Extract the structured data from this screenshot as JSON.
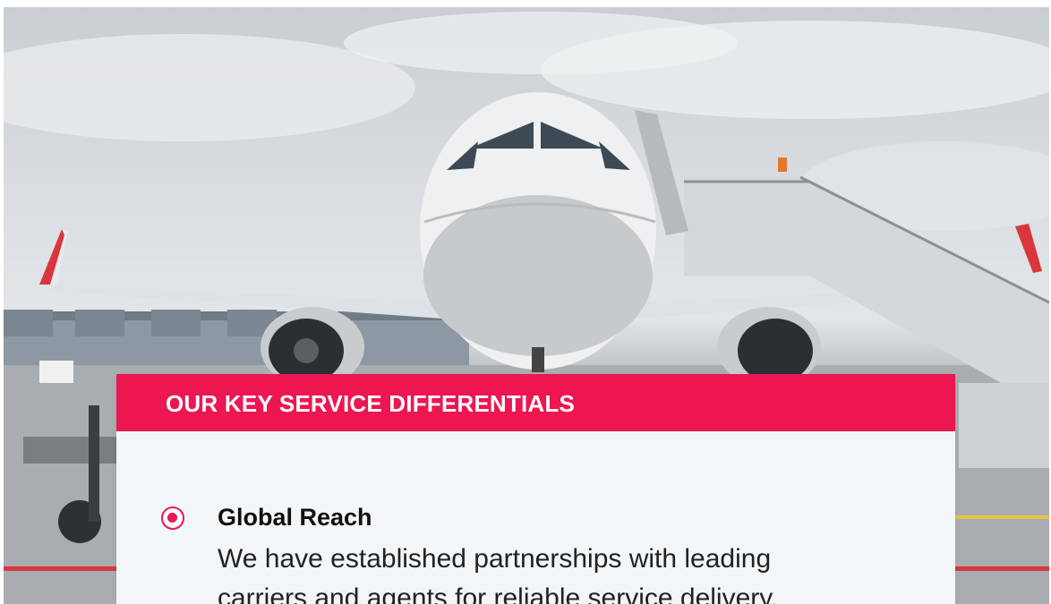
{
  "hero": {
    "image": "airplane-at-airport-gate-photo"
  },
  "card": {
    "title": "OUR KEY SERVICE DIFFERENTIALS",
    "accent_color": "#ec1651",
    "background_color": "#f3f6f9",
    "items": [
      {
        "icon": "radio-selected-icon",
        "title": "Global Reach",
        "description": "We have established partnerships with leading carriers and agents for reliable service delivery."
      }
    ]
  }
}
